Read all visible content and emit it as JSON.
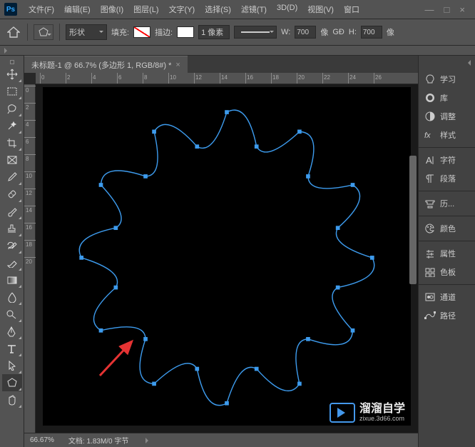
{
  "app": {
    "name": "Ps"
  },
  "menu": [
    "文件(F)",
    "编辑(E)",
    "图像(I)",
    "图层(L)",
    "文字(Y)",
    "选择(S)",
    "滤镜(T)",
    "3D(D)",
    "视图(V)",
    "窗口"
  ],
  "window_controls": {
    "min": "—",
    "max": "□",
    "close": "×"
  },
  "options": {
    "mode": "形状",
    "fill_label": "填充:",
    "stroke_label": "描边:",
    "stroke_px": "1 像素",
    "w_label": "W:",
    "w_value": "700",
    "w_unit": "像",
    "link": "GĐ",
    "h_label": "H:",
    "h_value": "700",
    "h_unit": "像"
  },
  "document": {
    "tab_title": "未标题-1 @ 66.7% (多边形 1, RGB/8#) *",
    "zoom": "66.67%",
    "doc_info": "文档:  1.83M/0 字节"
  },
  "ruler_h": [
    "0",
    "2",
    "4",
    "6",
    "8",
    "10",
    "12",
    "14",
    "16",
    "18",
    "20",
    "22",
    "24",
    "26"
  ],
  "ruler_v": [
    "0",
    "2",
    "4",
    "6",
    "8",
    "10",
    "12",
    "14",
    "16",
    "18",
    "20"
  ],
  "panels": {
    "group1": [
      {
        "icon": "lightbulb",
        "label": "学习"
      },
      {
        "icon": "cc",
        "label": "库"
      },
      {
        "icon": "adjust",
        "label": "调整"
      },
      {
        "icon": "fx",
        "label": "样式"
      }
    ],
    "group2": [
      {
        "icon": "char",
        "label": "字符"
      },
      {
        "icon": "para",
        "label": "段落"
      }
    ],
    "group3": [
      {
        "icon": "history",
        "label": "历..."
      }
    ],
    "group4": [
      {
        "icon": "palette",
        "label": "颜色"
      }
    ],
    "group5": [
      {
        "icon": "props",
        "label": "属性"
      },
      {
        "icon": "swatches",
        "label": "色板"
      }
    ],
    "group6": [
      {
        "icon": "channels",
        "label": "通道"
      },
      {
        "icon": "paths",
        "label": "路径"
      }
    ]
  },
  "tools": [
    "move",
    "marquee",
    "lasso",
    "wand",
    "crop",
    "frame",
    "eyedrop",
    "heal",
    "brush",
    "stamp",
    "history-brush",
    "eraser",
    "gradient",
    "blur",
    "dodge",
    "pen",
    "type",
    "path-sel",
    "shape",
    "hand"
  ],
  "watermark": {
    "title": "溜溜自学",
    "url": "zixue.3d66.com"
  }
}
